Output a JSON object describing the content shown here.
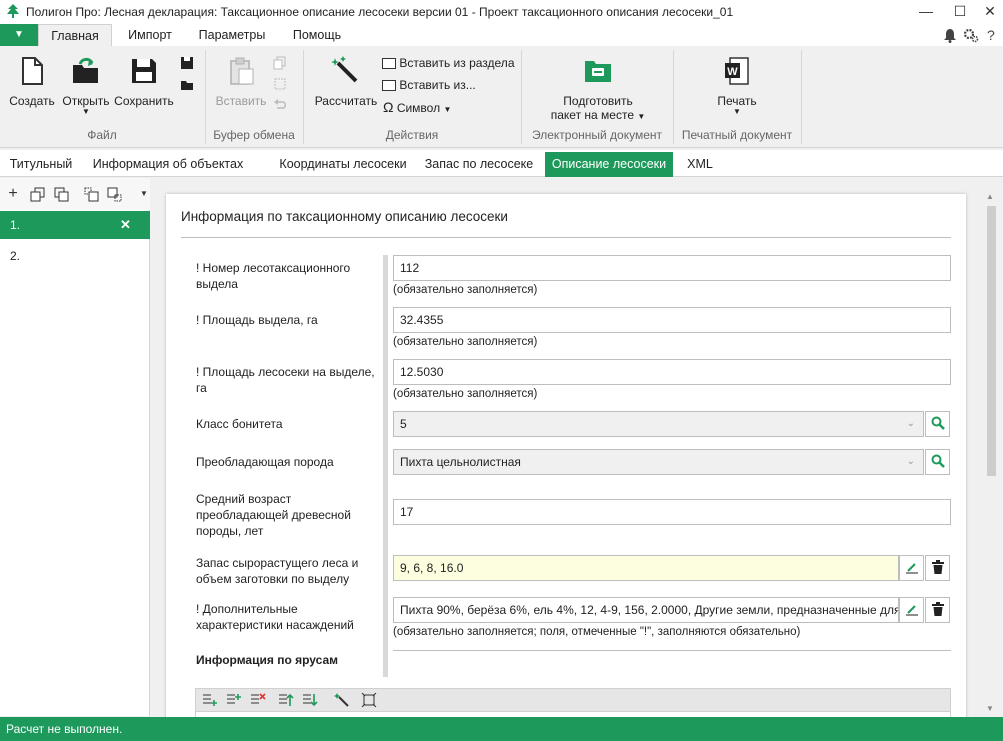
{
  "window": {
    "title": "Полигон Про: Лесная декларация: Таксационное описание лесосеки версии 01 - Проект таксационного описания лесосеки_01",
    "minimize": "—",
    "maximize": "☐",
    "close": "✕",
    "help": "?"
  },
  "menu": {
    "dropdown_glyph": "▼",
    "tabs": [
      "Главная",
      "Импорт",
      "Параметры",
      "Помощь"
    ]
  },
  "ribbon": {
    "file": {
      "create": "Создать",
      "open": "Открыть",
      "save": "Сохранить",
      "group": "Файл"
    },
    "clipboard": {
      "paste": "Вставить",
      "group": "Буфер обмена"
    },
    "actions": {
      "calculate": "Рассчитать",
      "insert_from_section": "Вставить из раздела",
      "insert_from": "Вставить из...",
      "symbol": "Символ",
      "group": "Действия"
    },
    "edoc": {
      "prepare_line1": "Подготовить",
      "prepare_line2": "пакет на месте",
      "group": "Электронный документ"
    },
    "pdoc": {
      "print": "Печать",
      "group": "Печатный документ"
    }
  },
  "section_tabs": [
    "Титульный",
    "Информация об объектах",
    "Координаты лесосеки",
    "Запас по лесосеке",
    "Описание лесосеки",
    "XML"
  ],
  "left_list": [
    "1.",
    "2."
  ],
  "card": {
    "title": "Информация по таксационному описанию лесосеки",
    "fields": [
      {
        "label": "! Номер лесотаксационного выдела",
        "value": "112",
        "hint": "(обязательно заполняется)"
      },
      {
        "label": "! Площадь выдела, га",
        "value": "32.4355",
        "hint": "(обязательно заполняется)"
      },
      {
        "label": "! Площадь лесосеки на выделе, га",
        "value": "12.5030",
        "hint": "(обязательно заполняется)"
      },
      {
        "label": "Класс бонитета",
        "value": "5"
      },
      {
        "label": "Преобладающая порода",
        "value": "Пихта цельнолистная"
      },
      {
        "label": "Средний возраст преобладающей древесной породы, лет",
        "value": "17"
      },
      {
        "label": "Запас сырорастущего леса и объем заготовки по выделу",
        "value": "9, 6, 8, 16.0"
      },
      {
        "label": "! Дополнительные характеристики насаждений",
        "value": "Пихта 90%, берёза 6%, ель 4%, 12, 4-9, 156, 2.0000, Другие земли, предназначенные для л",
        "hint": "(обязательно заполняется; поля, отмеченные \"!\", заполняются обязательно)"
      }
    ],
    "tiers_title": "Информация по ярусам"
  },
  "status": "Расчет не выполнен.",
  "colors": {
    "accent": "#1d9a5b"
  }
}
